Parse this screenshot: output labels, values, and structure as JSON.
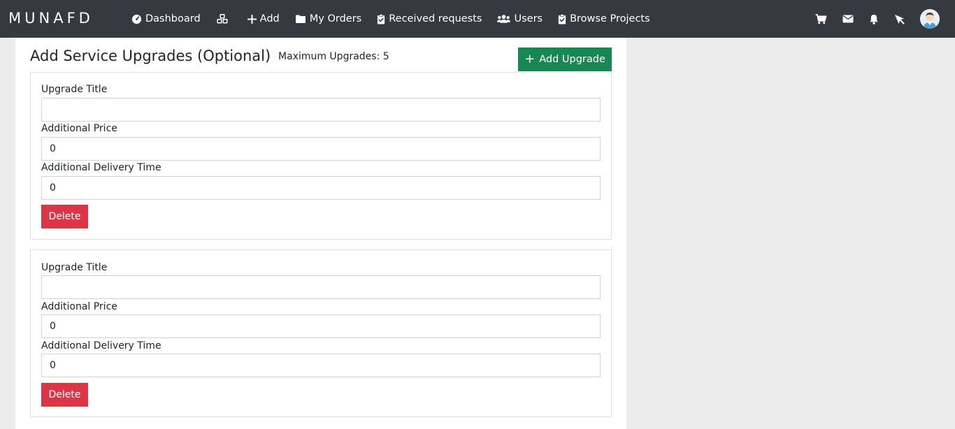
{
  "navbar": {
    "brand": "MUNAFD",
    "links": [
      {
        "label": "Dashboard",
        "icon": "dashboard-gauge-icon"
      },
      {
        "label": "",
        "icon": "cubes-icon"
      },
      {
        "label": "Add",
        "icon": "plus-icon"
      },
      {
        "label": "My Orders",
        "icon": "folder-icon"
      },
      {
        "label": "Received requests",
        "icon": "clipboard-check-icon"
      },
      {
        "label": "Users",
        "icon": "users-icon"
      },
      {
        "label": "Browse Projects",
        "icon": "clipboard-check-icon"
      }
    ],
    "right_icons": [
      "cart-icon",
      "envelope-icon",
      "bell-icon",
      "cursor-icon",
      "avatar"
    ]
  },
  "section": {
    "title": "Add Service Upgrades (Optional)",
    "max_upgrades": "Maximum Upgrades: 5",
    "add_button": "Add Upgrade"
  },
  "upgrades": [
    {
      "title_label": "Upgrade Title",
      "title_value": "",
      "price_label": "Additional Price",
      "price_value": "0",
      "delivery_label": "Additional Delivery Time",
      "delivery_value": "0",
      "delete_label": "Delete"
    },
    {
      "title_label": "Upgrade Title",
      "title_value": "",
      "price_label": "Additional Price",
      "price_value": "0",
      "delivery_label": "Additional Delivery Time",
      "delivery_value": "0",
      "delete_label": "Delete"
    }
  ],
  "colors": {
    "navbar": "#343a40",
    "success": "#198754",
    "danger": "#dc3545",
    "background": "#ececec"
  }
}
